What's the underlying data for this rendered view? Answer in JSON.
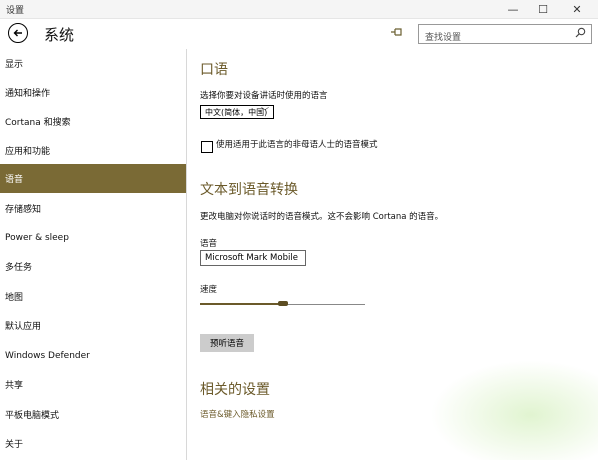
{
  "window": {
    "title": "设置",
    "controls": {
      "minimize": "—",
      "maximize": "☐",
      "close": "✕"
    }
  },
  "header": {
    "back_icon": "back-arrow-icon",
    "title": "系统",
    "pin_icon": "pin-icon",
    "search": {
      "placeholder": "查找设置",
      "icon": "search-icon"
    }
  },
  "sidebar": {
    "items": [
      {
        "label": "显示"
      },
      {
        "label": "通知和操作"
      },
      {
        "label": "Cortana 和搜索"
      },
      {
        "label": "应用和功能"
      },
      {
        "label": "语音",
        "active": true
      },
      {
        "label": "存储感知"
      },
      {
        "label": "Power & sleep"
      },
      {
        "label": "多任务"
      },
      {
        "label": "地图"
      },
      {
        "label": "默认应用"
      },
      {
        "label": "Windows Defender"
      },
      {
        "label": "共享"
      },
      {
        "label": "平板电脑模式"
      },
      {
        "label": "关于"
      }
    ]
  },
  "speech": {
    "title": "口语",
    "language_prompt": "选择你要对设备讲话时使用的语言",
    "language_value": "中文(简体，中国)",
    "nonnative_checkbox_label": "使用适用于此语言的非母语人士的语音模式",
    "nonnative_checked": false
  },
  "tts": {
    "title": "文本到语音转换",
    "description": "更改电脑对你说话时的语音模式。这不会影响 Cortana 的语音。",
    "voice_label": "语音",
    "voice_value": "Microsoft Mark Mobile",
    "speed_label": "速度",
    "speed_fraction": 0.5,
    "preview_button": "预听语音"
  },
  "related": {
    "title": "相关的设置",
    "link": "语音&键入隐私设置"
  },
  "colors": {
    "accent": "#7a6a35",
    "accent_text": "#6b5a2a"
  }
}
